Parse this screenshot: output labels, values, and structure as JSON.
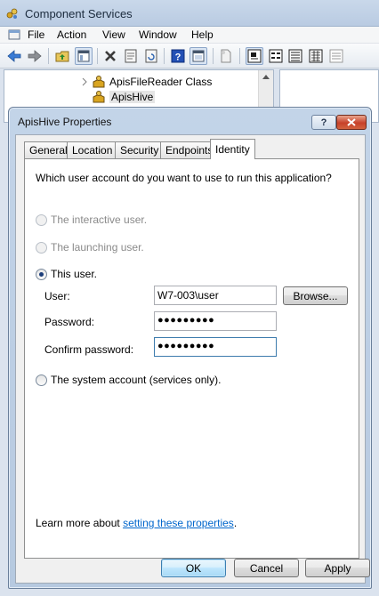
{
  "window": {
    "title": "Component Services",
    "menu": [
      "File",
      "Action",
      "View",
      "Window",
      "Help"
    ],
    "toolbar_icons": [
      "back-icon",
      "forward-icon",
      "up-folder-icon",
      "show-tree-icon",
      "delete-icon",
      "properties-icon",
      "refresh-icon",
      "help-icon",
      "console-icon",
      "new-icon",
      "large-icons-icon",
      "small-icons-icon",
      "list-view-icon",
      "detail-view-icon",
      "filter-view-icon"
    ]
  },
  "tree": {
    "items": [
      {
        "label": "ApisFileReader Class",
        "icon": "package-icon"
      },
      {
        "label": "ApisHive",
        "icon": "package-icon",
        "selected": true
      }
    ]
  },
  "dialog": {
    "title": "ApisHive Properties",
    "help_glyph": "?",
    "tabs": [
      "General",
      "Location",
      "Security",
      "Endpoints",
      "Identity"
    ],
    "active_tab": "Identity",
    "question": "Which user account do you want to use to run this application?",
    "options": {
      "interactive": "The interactive user.",
      "launching": "The launching user.",
      "this_user": "This user.",
      "system": "The system account (services only)."
    },
    "selected_option": "this_user",
    "fields": {
      "user_label": "User:",
      "user_value": "W7-003\\user",
      "password_label": "Password:",
      "password_value": "●●●●●●●●●",
      "confirm_label": "Confirm password:",
      "confirm_value": "●●●●●●●●●"
    },
    "browse_label": "Browse...",
    "learn_more_prefix": "Learn more about ",
    "learn_more_link": "setting these properties",
    "learn_more_suffix": ".",
    "buttons": {
      "ok": "OK",
      "cancel": "Cancel",
      "apply": "Apply"
    }
  },
  "colors": {
    "link": "#0066cc",
    "dialog_frame": "#b6c9e0",
    "close_button": "#c7412a"
  }
}
